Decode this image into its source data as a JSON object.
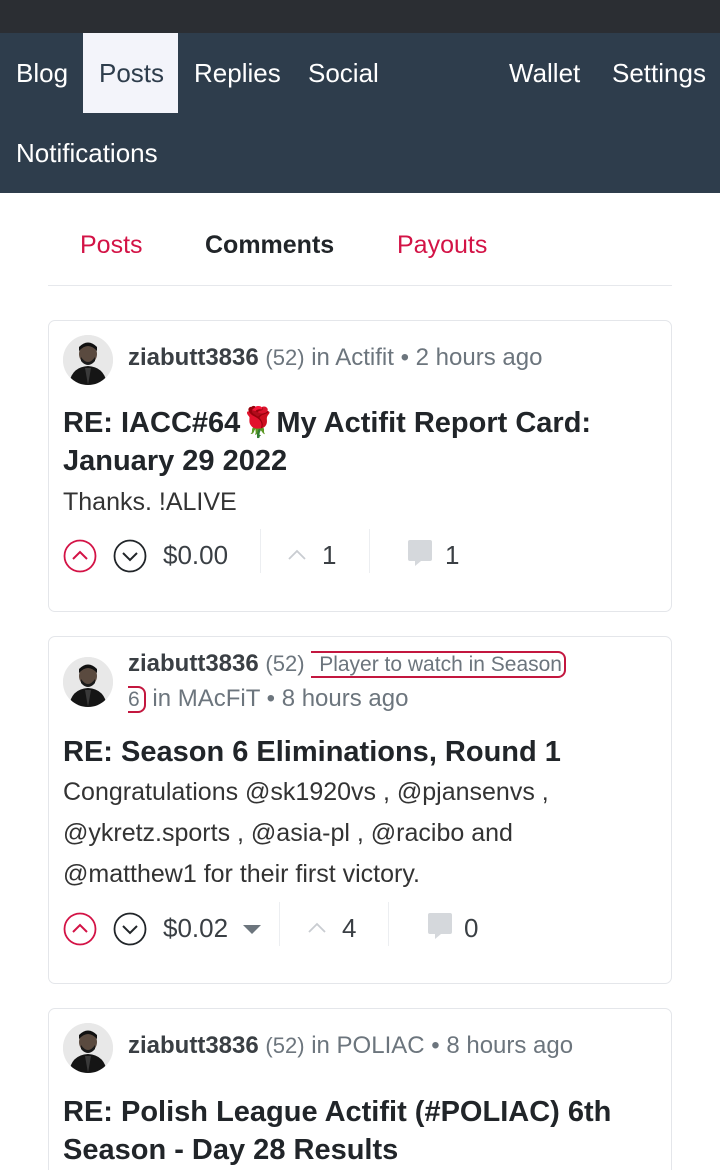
{
  "nav": {
    "items": [
      {
        "label": "Blog"
      },
      {
        "label": "Posts"
      },
      {
        "label": "Replies"
      },
      {
        "label": "Social"
      },
      {
        "label": "Wallet"
      },
      {
        "label": "Settings"
      },
      {
        "label": "Notifications"
      }
    ],
    "active": "Posts"
  },
  "subtabs": [
    {
      "label": "Posts"
    },
    {
      "label": "Comments"
    },
    {
      "label": "Payouts"
    }
  ],
  "posts": [
    {
      "author": "ziabutt3836",
      "reputation": "(52)",
      "in_label": "in",
      "community": "Actifit",
      "separator": "•",
      "time": "2 hours ago",
      "title": "RE: IACC#64🌹My Actifit Report Card: January 29 2022",
      "body": "Thanks. !ALIVE",
      "payout": "$0.00",
      "votes": "1",
      "comments": "1"
    },
    {
      "author": "ziabutt3836",
      "reputation": "(52)",
      "badge_line1": "Player to watch in Season",
      "badge_line2": "6",
      "in_label": "in",
      "community": "MAcFiT",
      "separator": "•",
      "time": "8 hours ago",
      "title": "RE: Season 6 Eliminations, Round 1",
      "body": "Congratulations @sk1920vs , @pjansenvs , @ykretz.sports , @asia-pl , @racibo and @matthew1 for their first victory.",
      "payout": "$0.02",
      "votes": "4",
      "comments": "0"
    },
    {
      "author": "ziabutt3836",
      "reputation": "(52)",
      "in_label": "in",
      "community": "POLIAC",
      "separator": "•",
      "time": "8 hours ago",
      "title": "RE: Polish League Actifit (#POLIAC) 6th Season - Day 28 Results"
    }
  ],
  "colors": {
    "nav_bg": "#2e3d4c",
    "active_tab_bg": "#f3f4fa",
    "accent_red": "#d31346",
    "status_bar": "#2b2e33"
  },
  "icons": {
    "upvote": "upvote-circle-icon",
    "downvote": "downvote-circle-icon",
    "votes": "chevron-up-icon",
    "comments": "comment-bubble-icon",
    "payout_caret": "caret-down-icon"
  }
}
